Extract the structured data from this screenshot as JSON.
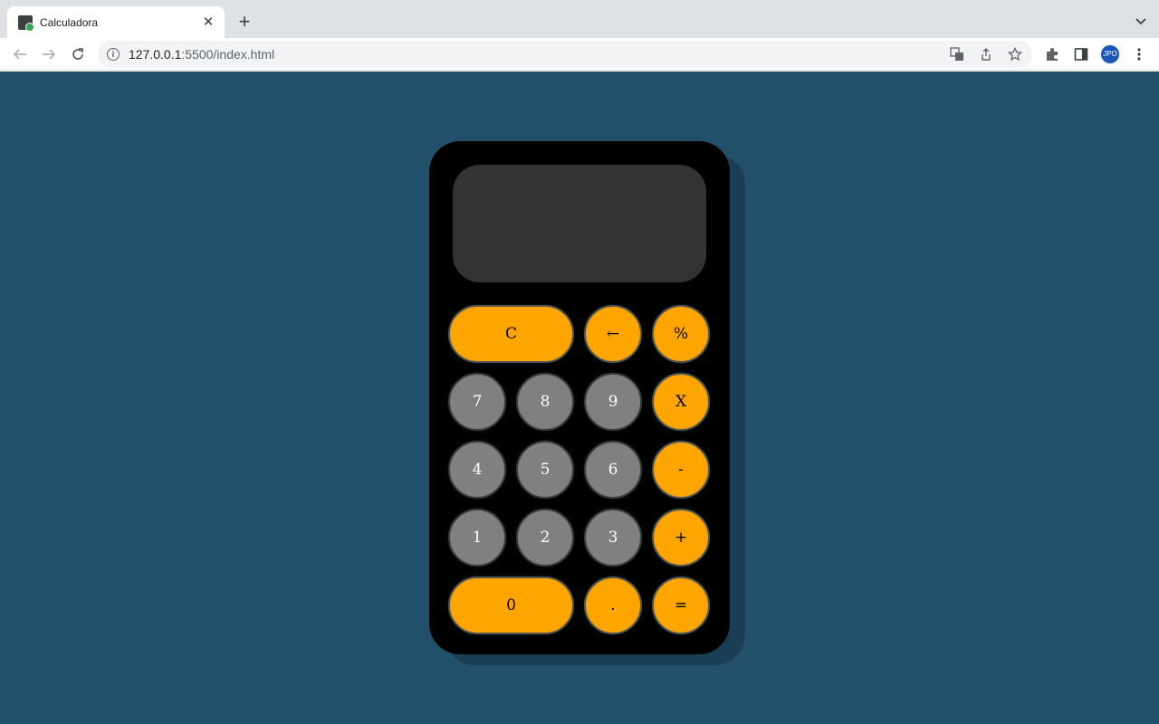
{
  "browser": {
    "tab_title": "Calculadora",
    "tab_close": "✕",
    "new_tab": "+",
    "url_host": "127.0.0.1",
    "url_path": ":5500/index.html",
    "avatar_text": "JPO"
  },
  "calculator": {
    "display_value": "",
    "keys": {
      "clear": "C",
      "backspace": "←",
      "percent": "%",
      "seven": "7",
      "eight": "8",
      "nine": "9",
      "multiply": "X",
      "four": "4",
      "five": "5",
      "six": "6",
      "minus": "-",
      "one": "1",
      "two": "2",
      "three": "3",
      "plus": "+",
      "zero": "0",
      "decimal": ".",
      "equals": "="
    },
    "colors": {
      "page_background": "#224f69",
      "body": "#000000",
      "display": "#333333",
      "operator_key": "#ffa500",
      "digit_key": "#808080"
    }
  }
}
